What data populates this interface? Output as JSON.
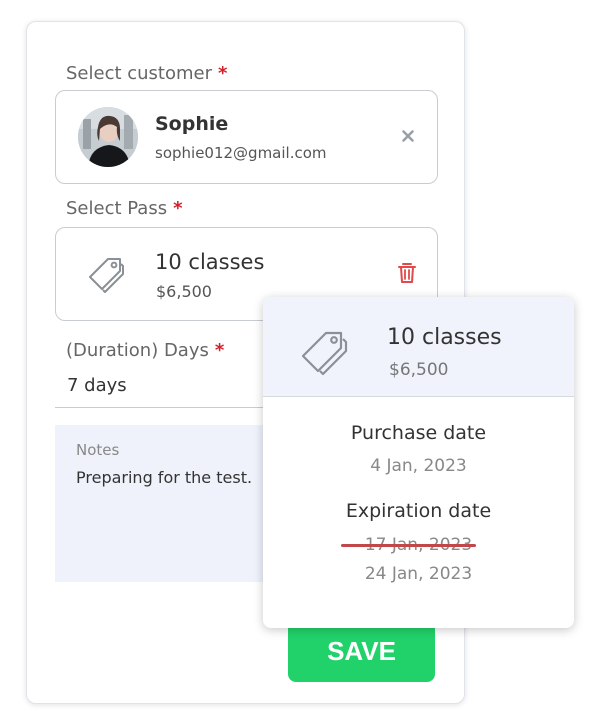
{
  "form": {
    "customer_label": "Select customer",
    "pass_label": "Select Pass",
    "duration_label": "(Duration) Days",
    "required_mark": "*"
  },
  "customer": {
    "name": "Sophie",
    "email": "sophie012@gmail.com"
  },
  "pass": {
    "name": "10 classes",
    "price": "$6,500"
  },
  "duration": {
    "value": "7 days"
  },
  "notes": {
    "label": "Notes",
    "text": "Preparing for the test."
  },
  "save_button": {
    "label": "SAVE"
  },
  "popup": {
    "pass_name": "10 classes",
    "pass_price": "$6,500",
    "purchase_label": "Purchase date",
    "purchase_date": "4 Jan, 2023",
    "expiration_label": "Expiration date",
    "old_expiration": "17 Jan, 2023",
    "new_expiration": "24 Jan, 2023"
  },
  "colors": {
    "accent_green": "#21d26b",
    "required_red": "#d0202a",
    "notes_bg": "#eff2fb",
    "popup_header_bg": "#f0f3fc"
  },
  "icons": [
    "close-icon",
    "tag-icon",
    "trash-icon"
  ]
}
